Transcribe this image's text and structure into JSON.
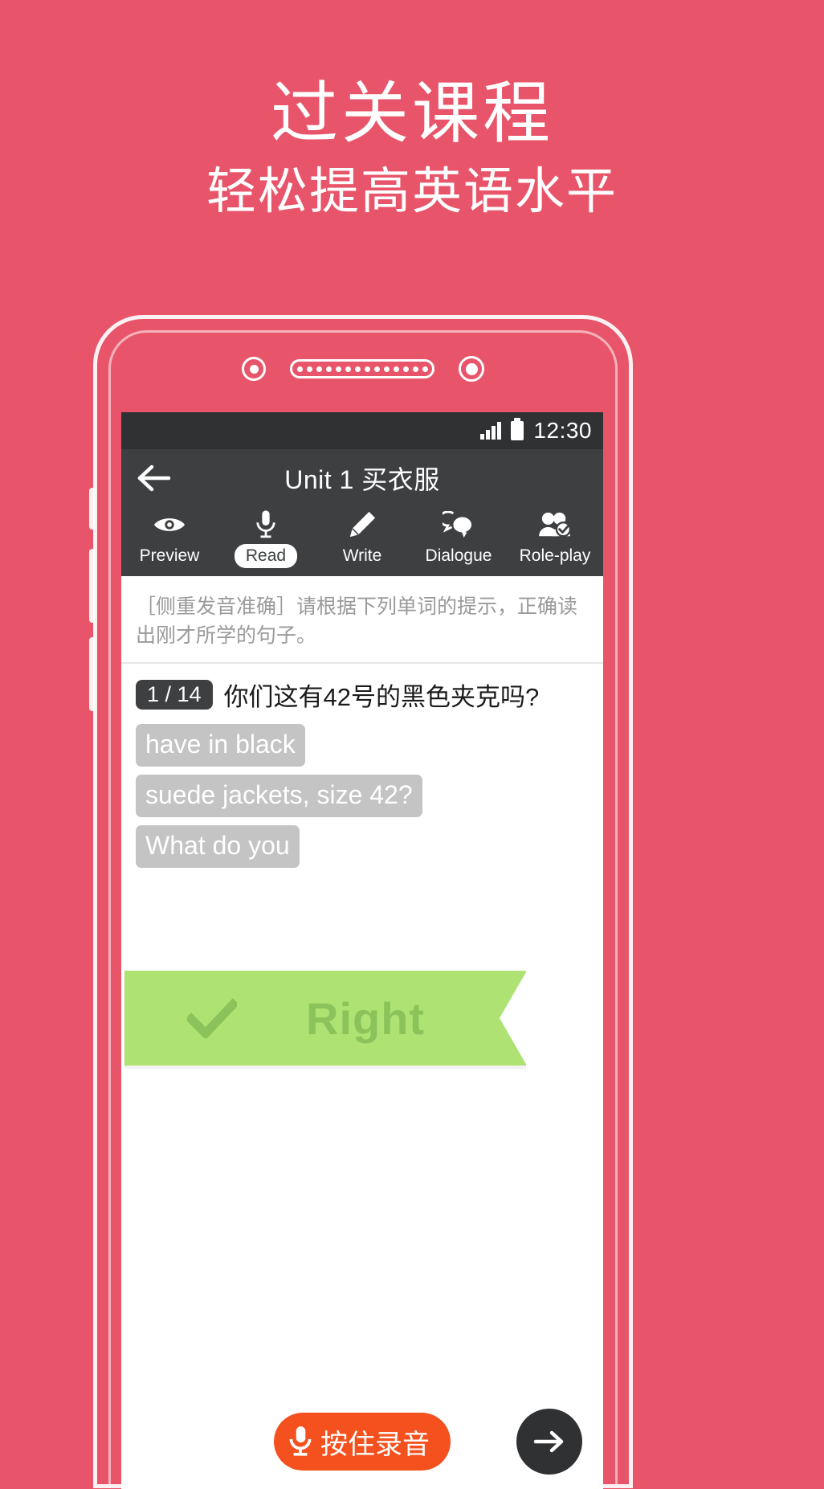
{
  "promo": {
    "title": "过关课程",
    "subtitle": "轻松提高英语水平"
  },
  "colors": {
    "background": "#e8556a",
    "statusbar": "#2f3133",
    "titlebar": "#3d3f41",
    "chip": "#c4c4c4",
    "ribbon": "#aee373",
    "ribbon_text": "#8bc35a",
    "record_button": "#f4511e",
    "next_button": "#2f3133"
  },
  "phone": {
    "camera_icon": "camera-icon",
    "speaker_icon": "speaker-grille-icon",
    "sensor_icon": "sensor-icon"
  },
  "statusbar": {
    "signal_icon": "signal-bars-icon",
    "battery_icon": "battery-icon",
    "time": "12:30"
  },
  "titlebar": {
    "back_icon": "back-arrow-icon",
    "title": "Unit 1 买衣服"
  },
  "tabs": [
    {
      "label": "Preview",
      "icon": "eye-icon",
      "active": false
    },
    {
      "label": "Read",
      "icon": "microphone-icon",
      "active": true
    },
    {
      "label": "Write",
      "icon": "pencil-icon",
      "active": false
    },
    {
      "label": "Dialogue",
      "icon": "speech-bubbles-icon",
      "active": false
    },
    {
      "label": "Role-play",
      "icon": "user-check-icon",
      "active": false
    }
  ],
  "content": {
    "instructions": "［侧重发音准确］请根据下列单词的提示，正确读出刚才所学的句子。",
    "question_badge": "1 / 14",
    "question_text": "你们这有42号的黑色夹克吗?",
    "chips": [
      "have in black",
      "suede jackets, size 42?",
      "What do you"
    ],
    "verdict": {
      "text": "Right",
      "icon": "checkmark-icon"
    }
  },
  "bottombar": {
    "record_label": "按住录音",
    "record_icon": "microphone-icon",
    "next_icon": "arrow-right-icon"
  }
}
